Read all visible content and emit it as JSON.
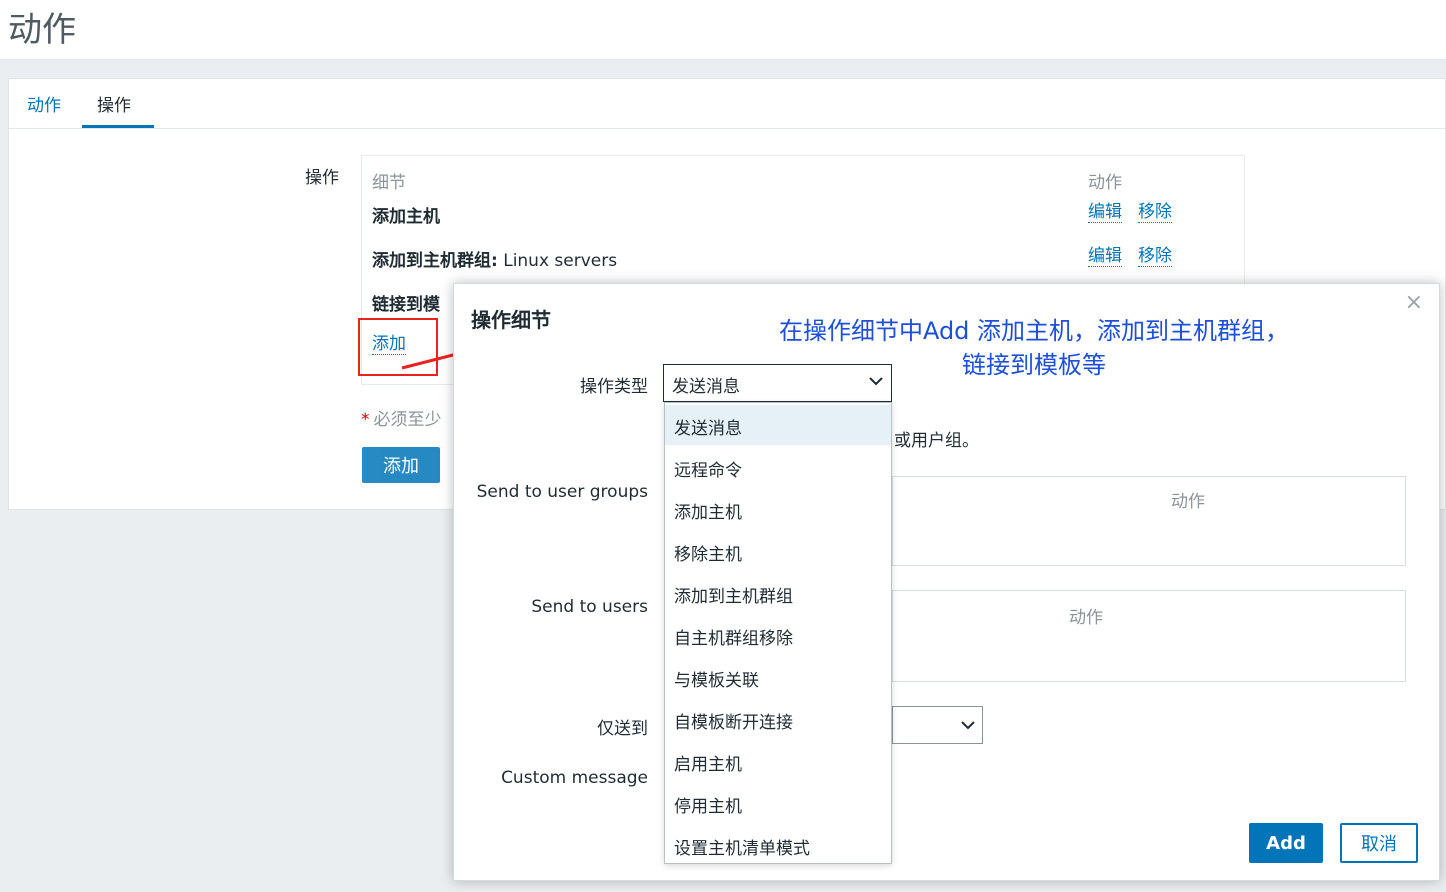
{
  "page": {
    "title": "动作"
  },
  "tabs": [
    {
      "label": "动作"
    },
    {
      "label": "操作"
    }
  ],
  "operations": {
    "label": "操作",
    "headers": {
      "details": "细节",
      "actions": "动作"
    },
    "rows": [
      {
        "bold": "添加主机",
        "rest": "",
        "edit": "编辑",
        "remove": "移除"
      },
      {
        "bold": "添加到主机群组:",
        "rest": " Linux servers",
        "edit": "编辑",
        "remove": "移除"
      },
      {
        "bold": "链接到模",
        "rest": ""
      }
    ],
    "add_link": "添加",
    "required_note": "必须至少",
    "add_button": "添加"
  },
  "annotation": {
    "line1": "在操作细节中Add 添加主机，添加到主机群组，",
    "line2": "链接到模板等"
  },
  "modal": {
    "title": "操作细节",
    "close": "×",
    "fields": {
      "op_type_label": "操作类型",
      "op_type_value": "发送消息",
      "send_groups_label": "Send to user groups",
      "send_users_label": "Send to users",
      "only_send_label": "仅送到",
      "custom_message_label": "Custom message"
    },
    "partial_text": "或用户组。",
    "groups_table_action": "动作",
    "users_table_action": "动作",
    "dropdown_options": [
      "发送消息",
      "远程命令",
      "添加主机",
      "移除主机",
      "添加到主机群组",
      "自主机群组移除",
      "与模板关联",
      "自模板断开连接",
      "启用主机",
      "停用主机",
      "设置主机清单模式"
    ],
    "buttons": {
      "add": "Add",
      "cancel": "取消"
    }
  },
  "colors": {
    "accent": "#0275b8",
    "highlight": "#e8231f",
    "annotation": "#1d4fd8"
  }
}
